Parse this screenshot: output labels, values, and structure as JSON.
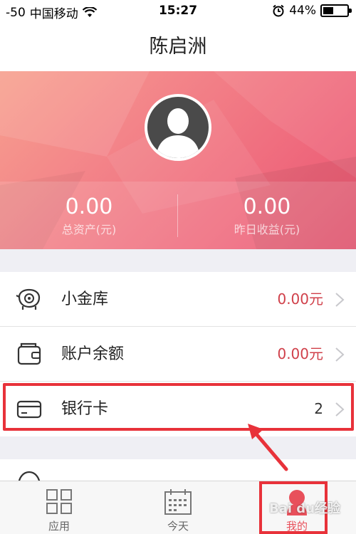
{
  "status_bar": {
    "signal": "-50",
    "carrier": "中国移动",
    "time": "15:27",
    "battery": "44%",
    "battery_level": 0.44
  },
  "nav": {
    "title": "陈启洲"
  },
  "stats": [
    {
      "value": "0.00",
      "label": "总资产(元)"
    },
    {
      "value": "0.00",
      "label": "昨日收益(元)"
    }
  ],
  "list": [
    {
      "label": "小金库",
      "value": "0.00元",
      "icon": "piggy-bank-icon"
    },
    {
      "label": "账户余额",
      "value": "0.00元",
      "icon": "wallet-icon"
    },
    {
      "label": "银行卡",
      "value": "2",
      "icon": "bank-card-icon"
    }
  ],
  "tabs": [
    {
      "label": "应用",
      "icon": "grid-icon"
    },
    {
      "label": "今天",
      "icon": "calendar-icon"
    },
    {
      "label": "我的",
      "icon": "user-icon"
    }
  ],
  "watermark": "Bai du经验",
  "colors": {
    "accent": "#e8505b",
    "value_red": "#d0404a",
    "annotation": "#e8323a"
  }
}
